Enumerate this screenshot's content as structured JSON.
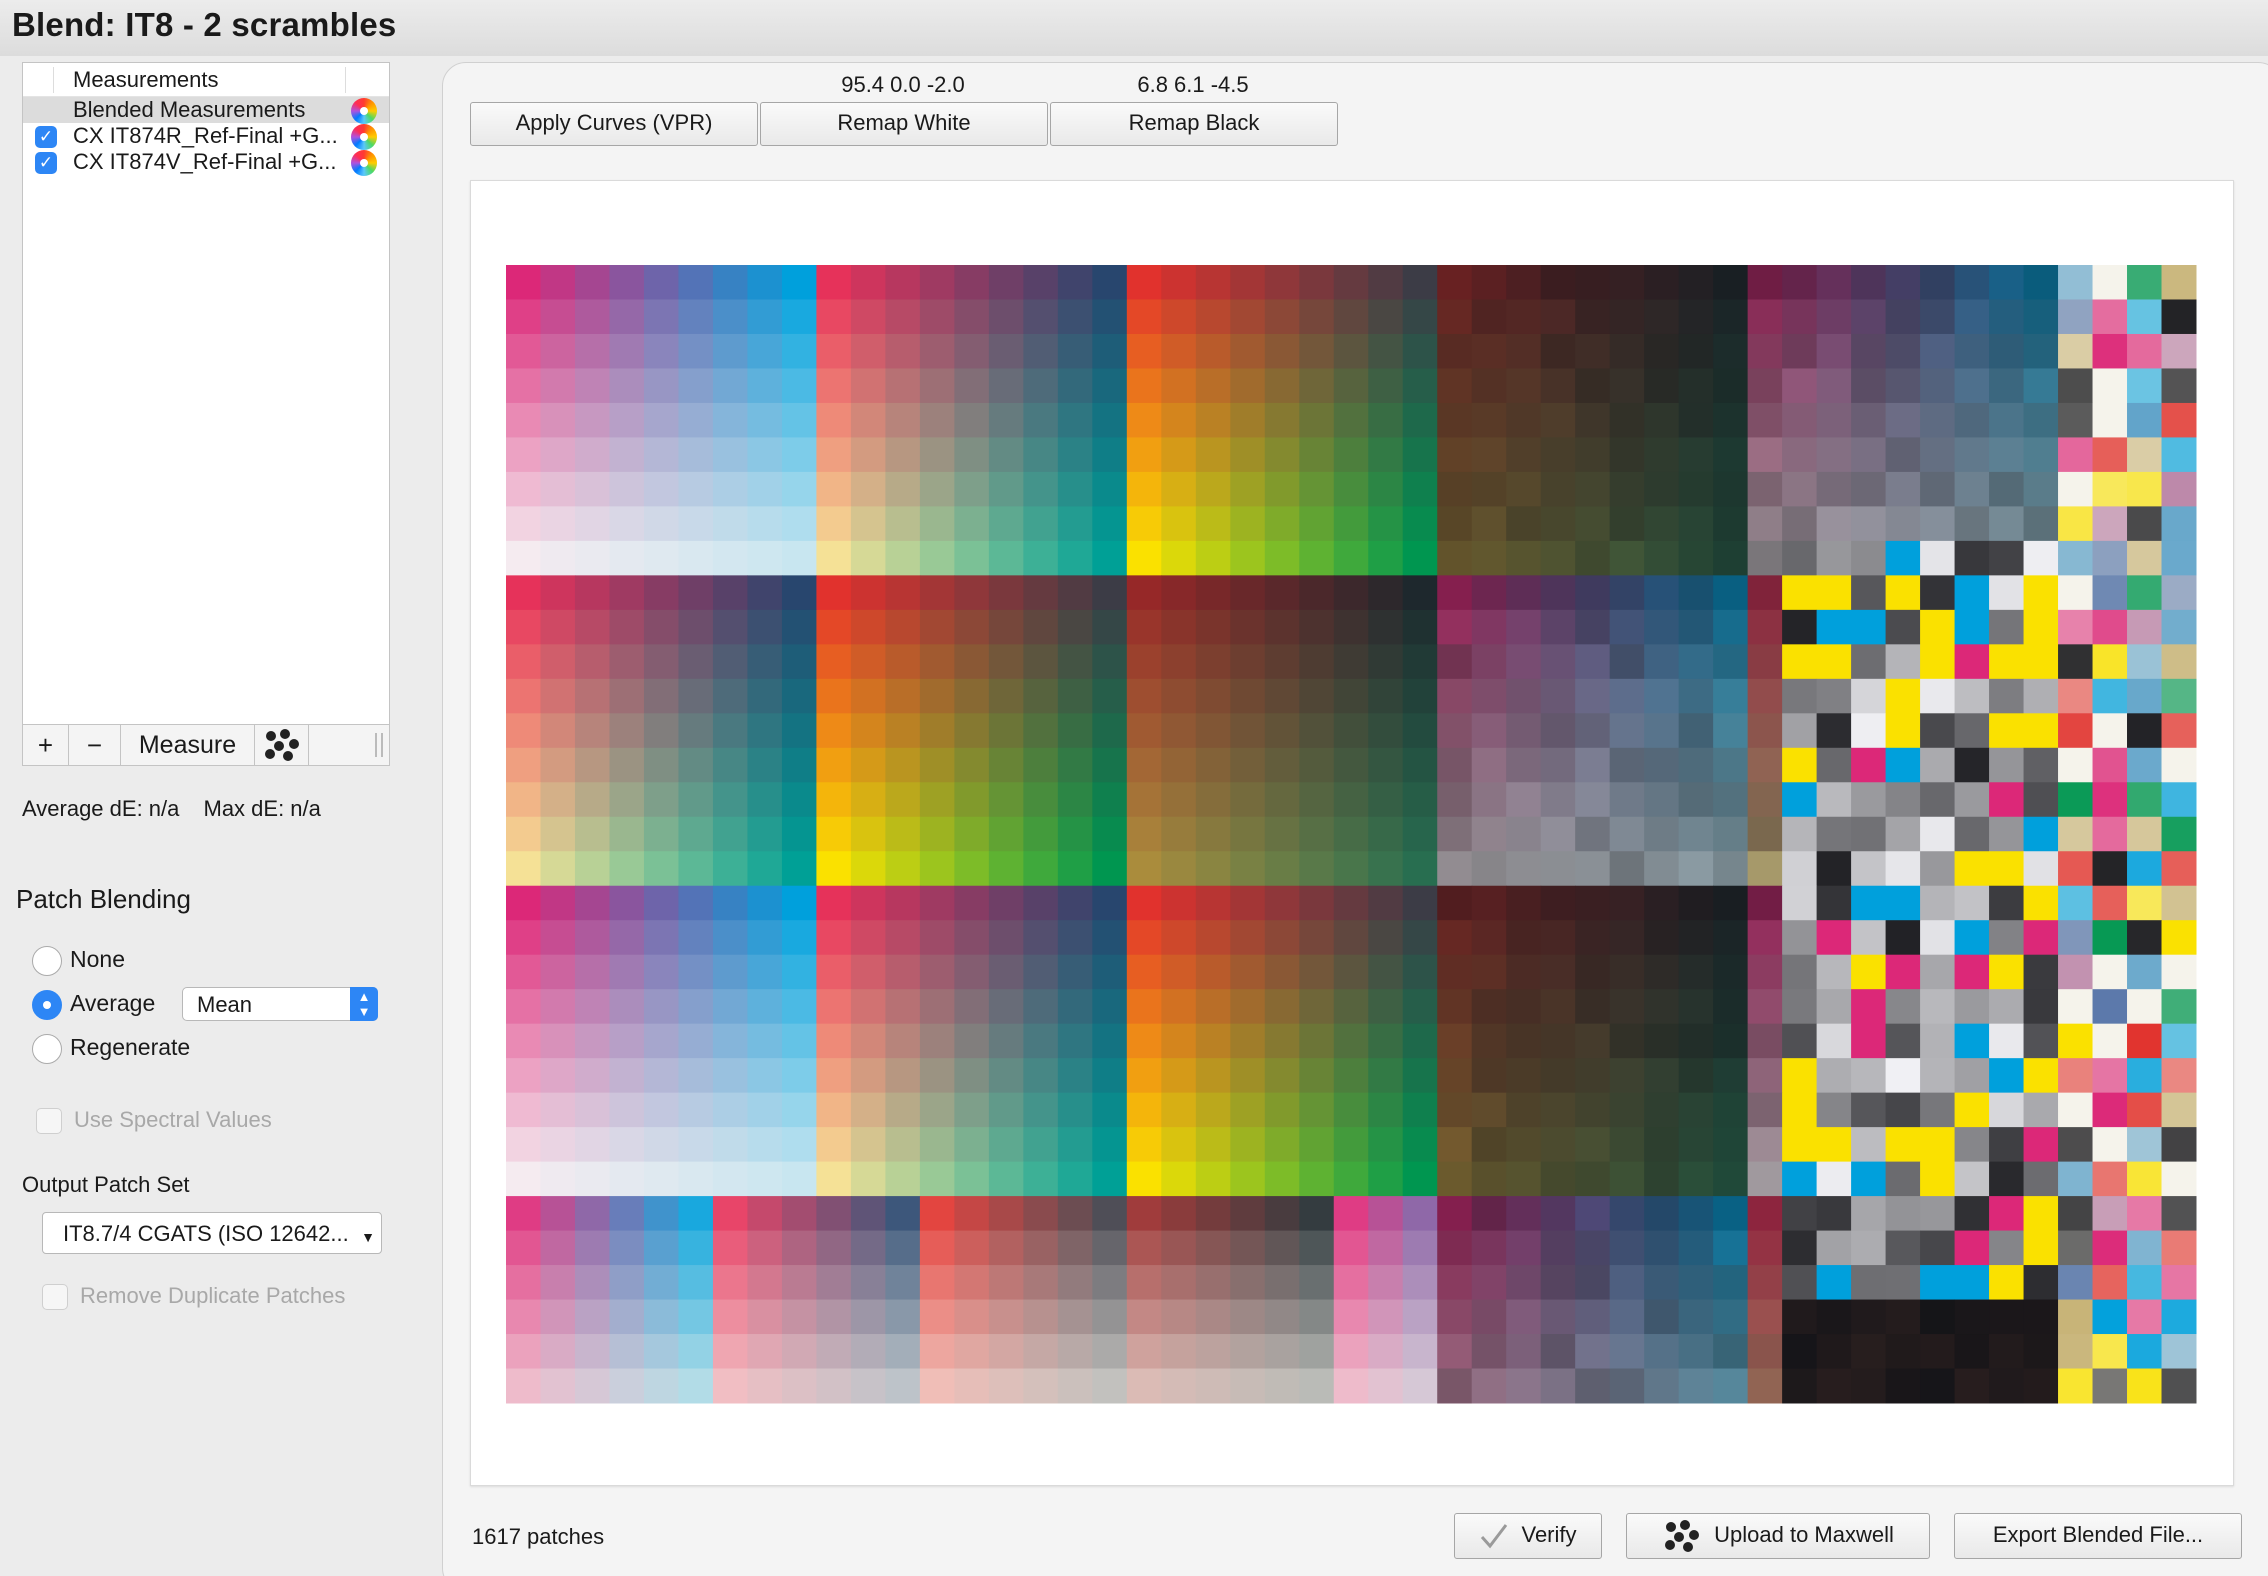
{
  "window": {
    "title": "Blend: IT8 - 2 scrambles"
  },
  "measurement_list": {
    "header": "Measurements",
    "items": [
      {
        "label": "Blended Measurements",
        "checked": null,
        "selected": true
      },
      {
        "label": "CX IT874R_Ref-Final +G...",
        "checked": true,
        "selected": false
      },
      {
        "label": "CX IT874V_Ref-Final +G...",
        "checked": true,
        "selected": false
      }
    ],
    "check_mark": "✓",
    "toolbar": {
      "add": "+",
      "remove": "−",
      "measure": "Measure",
      "device_icon": "maxwell-icon"
    }
  },
  "stats": {
    "average": "Average dE: n/a",
    "max": "Max dE: n/a"
  },
  "patch_blending": {
    "title": "Patch Blending",
    "options": [
      {
        "label": "None",
        "selected": false
      },
      {
        "label": "Average",
        "selected": true
      },
      {
        "label": "Regenerate",
        "selected": false
      }
    ],
    "average_method": "Mean",
    "use_spectral_label": "Use Spectral Values",
    "use_spectral_checked": false
  },
  "output": {
    "title": "Output Patch Set",
    "value": "IT8.7/4 CGATS (ISO 12642...",
    "remove_duplicates_label": "Remove Duplicate Patches",
    "remove_duplicates_checked": false
  },
  "top_buttons": {
    "apply_curves": "Apply Curves (VPR)",
    "remap_white": "Remap White",
    "remap_white_value": "95.4 0.0 -2.0",
    "remap_black": "Remap Black",
    "remap_black_value": "6.8 6.1 -4.5"
  },
  "patch_count": "1617 patches",
  "bottom_buttons": {
    "verify": "Verify",
    "upload": "Upload to Maxwell",
    "export": "Export Blended File..."
  },
  "colors": {
    "accent": "#2d86f5",
    "chart_background": "#ffffff"
  }
}
